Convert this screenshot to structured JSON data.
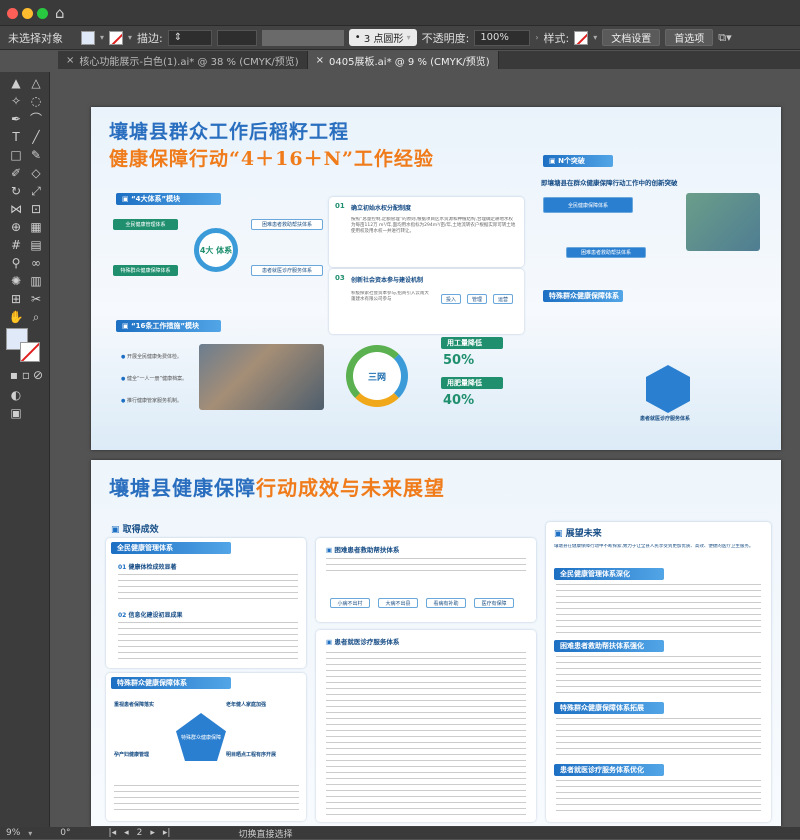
{
  "colors": {
    "accent_blue": "#1d6fc3",
    "title_blue": "#2a6fbf",
    "title_orange": "#f07b1a",
    "traffic_red": "#ff5f57",
    "traffic_yellow": "#febc2e",
    "traffic_green": "#28c840"
  },
  "control_bar": {
    "selection": "未选择对象",
    "stroke_label": "描边:",
    "stroke_shape": "3 点圆形",
    "opacity_label": "不透明度:",
    "opacity_value": "100%",
    "style_label": "样式:",
    "doc_settings": "文档设置",
    "preferences": "首选项"
  },
  "tabs": [
    {
      "label": "核心功能展示-白色(1).ai* @ 38 % (CMYK/预览)"
    },
    {
      "label": "0405展板.ai* @ 9 % (CMYK/预览)"
    }
  ],
  "status": {
    "zoom": "9%",
    "rotation": "0°",
    "artboard": "2",
    "tool": "切换直接选择"
  },
  "board1": {
    "title_line1": "壤塘县群众工作后稻籽工程",
    "title_line2": "健康保障行动“4＋16＋N”工作经验",
    "module1": "“4大体系”模块",
    "systems": [
      "全民健康管理体系",
      "困难患者救助帮扶体系",
      "特殊群众健康保障体系",
      "患者就医诊疗服务体系"
    ],
    "center": "4大 体系",
    "module2": "“16条工作措施”模块",
    "measures": [
      "开展全民健康免费体检。",
      "健全“一人一册”健康档案。",
      "推行健康管家服务机制。"
    ],
    "item01": "确立初始水权分配制度",
    "item01_text": "按照“总量控制,定额管理”的原则,根据项目区水资源和种植结构,合理确定耕地水权为每亩112万 m³/年,面均用水指标为294m³/亩/年,土地流转农户根据实际可转土地使用权及用水权一并进行转让。",
    "item03": "创新社会资本参与建设机制",
    "item03_text": "积极探索社会资本参与,招商引入云南大蓬建水有限公司参与",
    "flow": [
      "投入",
      "管理",
      "运营"
    ],
    "center2": "三网",
    "right_title": "N个突破",
    "right_subtitle": "即壤塘县在群众健康保障行动工作中的创新突破",
    "stat1_title": "用工量降低",
    "stat1_num": "50",
    "stat2_title": "用肥量降低",
    "stat2_num": "40",
    "stat_pct": "%",
    "right_boxes": [
      "全民健康保障体系",
      "困难患者救助帮扶体系",
      "特殊群众健康保障体系",
      "患者就医诊疗服务体系"
    ]
  },
  "board2": {
    "title_blue": "壤塘县健康保障",
    "title_orange": "行动成效与未来展望",
    "left_title": "取得成效",
    "sys1": "全民健康管理体系",
    "sub01": "健康体检成效显著",
    "sub02": "信息化建设初显成果",
    "sys2": "特殊群众健康保障体系",
    "mid1": "困难患者救助帮扶体系",
    "mid_tags": [
      "小病不出村",
      "大病不出县",
      "看病有补助",
      "医疗有保障"
    ],
    "mid2": "患者就医诊疗服务体系",
    "right_title": "展望未来",
    "right_intro": "壤塘县在健康保障行动中不断探索,致力于让全县人民享受到更加优质、高效、便捷的医疗卫生服务。",
    "right_secs": [
      "全民健康管理体系深化",
      "困难患者救助帮扶体系强化",
      "特殊群众健康保障体系拓展",
      "患者就医诊疗服务体系优化"
    ],
    "special": [
      "重视患者保障落实",
      "老年健人家庭加强",
      "孕产妇健康管理",
      "明目晒点工程有序开展"
    ],
    "special_center": "特殊群众健康保障"
  }
}
